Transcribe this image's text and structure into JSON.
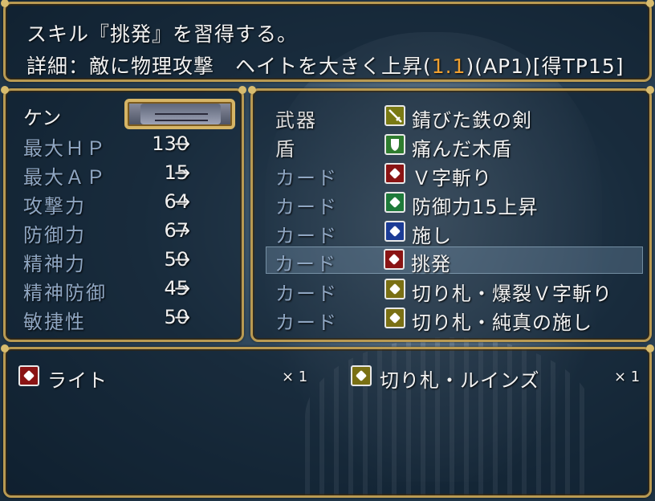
{
  "help": {
    "line1": "スキル『挑発』を習得する。",
    "line2_prefix": "詳細：敵に物理攻撃　ヘイトを大きく上昇(",
    "line2_value": "1.1",
    "line2_suffix": ")(AP1)[得TP15]"
  },
  "actor": {
    "name": "ケン"
  },
  "stats": [
    {
      "label": "最大ＨＰ",
      "value": "130",
      "arrow": "→"
    },
    {
      "label": "最大ＡＰ",
      "value": "15",
      "arrow": "→"
    },
    {
      "label": "攻撃力",
      "value": "64",
      "arrow": "→"
    },
    {
      "label": "防御力",
      "value": "67",
      "arrow": "→"
    },
    {
      "label": "精神力",
      "value": "50",
      "arrow": "→"
    },
    {
      "label": "精神防御",
      "value": "45",
      "arrow": "→"
    },
    {
      "label": "敏捷性",
      "value": "50",
      "arrow": "→"
    }
  ],
  "equips": [
    {
      "slot": "武器",
      "name": "錆びた鉄の剣",
      "icon": "sword-icon",
      "color": "#7a7a14"
    },
    {
      "slot": "盾",
      "name": "痛んだ木盾",
      "icon": "shield-icon",
      "color": "#2f7d2f"
    },
    {
      "slot": "カード",
      "name": "Ｖ字斬り",
      "icon": "card-icon",
      "color": "#8a1414"
    },
    {
      "slot": "カード",
      "name": "防御力15上昇",
      "icon": "card-icon",
      "color": "#1e7a3a"
    },
    {
      "slot": "カード",
      "name": "施し",
      "icon": "card-icon",
      "color": "#1c3c96"
    },
    {
      "slot": "カード",
      "name": "挑発",
      "icon": "card-icon",
      "color": "#8a1414"
    },
    {
      "slot": "カード",
      "name": "切り札・爆裂Ｖ字斬り",
      "icon": "card-icon",
      "color": "#7a7014"
    },
    {
      "slot": "カード",
      "name": "切り札・純真の施し",
      "icon": "card-icon",
      "color": "#7a7014"
    }
  ],
  "items": [
    {
      "name": "ライト",
      "count": "× 1",
      "icon": "card-icon",
      "color": "#8a1414"
    },
    {
      "name": "切り札・ルインズ",
      "count": "× 1",
      "icon": "card-icon",
      "color": "#7a7014"
    }
  ]
}
